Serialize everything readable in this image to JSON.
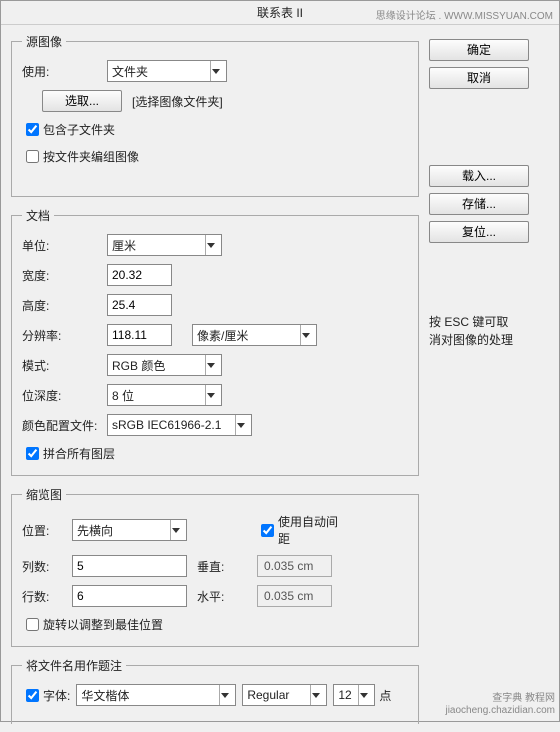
{
  "window": {
    "title": "联系表 II"
  },
  "watermark": {
    "top": "思缘设计论坛 . WWW.MISSYUAN.COM",
    "bottom_main": "查字典 教程网",
    "bottom_url": "jiaocheng.chazidian.com"
  },
  "source_image": {
    "legend": "源图像",
    "use_label": "使用:",
    "use_value": "文件夹",
    "choose_btn": "选取...",
    "choose_hint": "[选择图像文件夹]",
    "include_sub_label": "包含子文件夹",
    "group_by_folder_label": "按文件夹编组图像"
  },
  "document": {
    "legend": "文档",
    "unit_label": "单位:",
    "unit_value": "厘米",
    "width_label": "宽度:",
    "width_value": "20.32",
    "height_label": "高度:",
    "height_value": "25.4",
    "res_label": "分辨率:",
    "res_value": "118.11",
    "res_unit_value": "像素/厘米",
    "mode_label": "模式:",
    "mode_value": "RGB 颜色",
    "depth_label": "位深度:",
    "depth_value": "8 位",
    "profile_label": "颜色配置文件:",
    "profile_value": "sRGB IEC61966-2.1",
    "flatten_label": "拼合所有图层"
  },
  "thumbnail": {
    "legend": "缩览图",
    "position_label": "位置:",
    "position_value": "先横向",
    "autospace_label": "使用自动间距",
    "cols_label": "列数:",
    "cols_value": "5",
    "rows_label": "行数:",
    "rows_value": "6",
    "vspace_label": "垂直:",
    "vspace_value": "0.035 cm",
    "hspace_label": "水平:",
    "hspace_value": "0.035 cm",
    "rotate_label": "旋转以调整到最佳位置"
  },
  "caption": {
    "legend": "将文件名用作题注",
    "font_label": "字体:",
    "font_family": "华文楷体",
    "font_style": "Regular",
    "font_size": "12",
    "font_unit": "点"
  },
  "buttons": {
    "ok": "确定",
    "cancel": "取消",
    "load": "载入...",
    "save": "存储...",
    "reset": "复位..."
  },
  "esc_text": {
    "line1": "按 ESC 键可取",
    "line2": "消对图像的处理"
  }
}
